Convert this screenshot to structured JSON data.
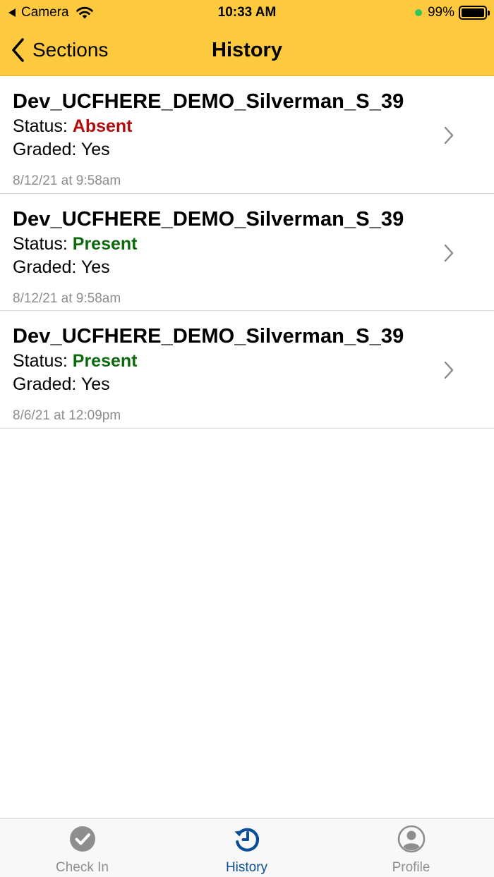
{
  "status_bar": {
    "back_app": "Camera",
    "time": "10:33 AM",
    "battery_percent": "99%",
    "battery_level": 0.99
  },
  "nav": {
    "back_label": "Sections",
    "title": "History"
  },
  "history": [
    {
      "course": "Dev_UCFHERE_DEMO_Silverman_S_39",
      "status_label": "Status: ",
      "status": "Absent",
      "graded": "Graded: Yes",
      "date": "8/12/21 at 9:58am"
    },
    {
      "course": "Dev_UCFHERE_DEMO_Silverman_S_39",
      "status_label": "Status: ",
      "status": "Present",
      "graded": "Graded: Yes",
      "date": "8/12/21 at 9:58am"
    },
    {
      "course": "Dev_UCFHERE_DEMO_Silverman_S_39",
      "status_label": "Status: ",
      "status": "Present",
      "graded": "Graded: Yes",
      "date": "8/6/21 at 12:09pm"
    }
  ],
  "tabs": [
    {
      "label": "Check In",
      "icon": "check-circle-icon",
      "active": false
    },
    {
      "label": "History",
      "icon": "history-icon",
      "active": true
    },
    {
      "label": "Profile",
      "icon": "person-circle-icon",
      "active": false
    }
  ],
  "colors": {
    "header_bg": "#fdc93e",
    "absent": "#b30c0c",
    "present": "#0d6b0d",
    "tab_active": "#0a4e97",
    "tab_inactive": "#8e8e8e",
    "date_text": "#8e8e8e"
  }
}
